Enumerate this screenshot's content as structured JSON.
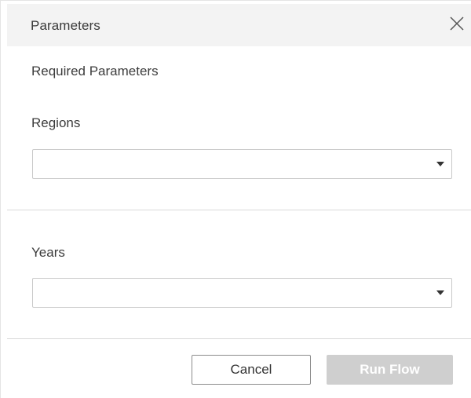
{
  "dialog": {
    "title": "Parameters",
    "close_icon": "close-icon"
  },
  "section": {
    "heading": "Required Parameters"
  },
  "fields": {
    "regions": {
      "label": "Regions",
      "value": ""
    },
    "years": {
      "label": "Years",
      "value": ""
    }
  },
  "footer": {
    "cancel_label": "Cancel",
    "run_label": "Run Flow",
    "run_enabled": false
  },
  "colors": {
    "header_bg": "#f3f3f3",
    "disabled_button_bg": "#cfcfcf",
    "border": "#c9c9c9"
  }
}
